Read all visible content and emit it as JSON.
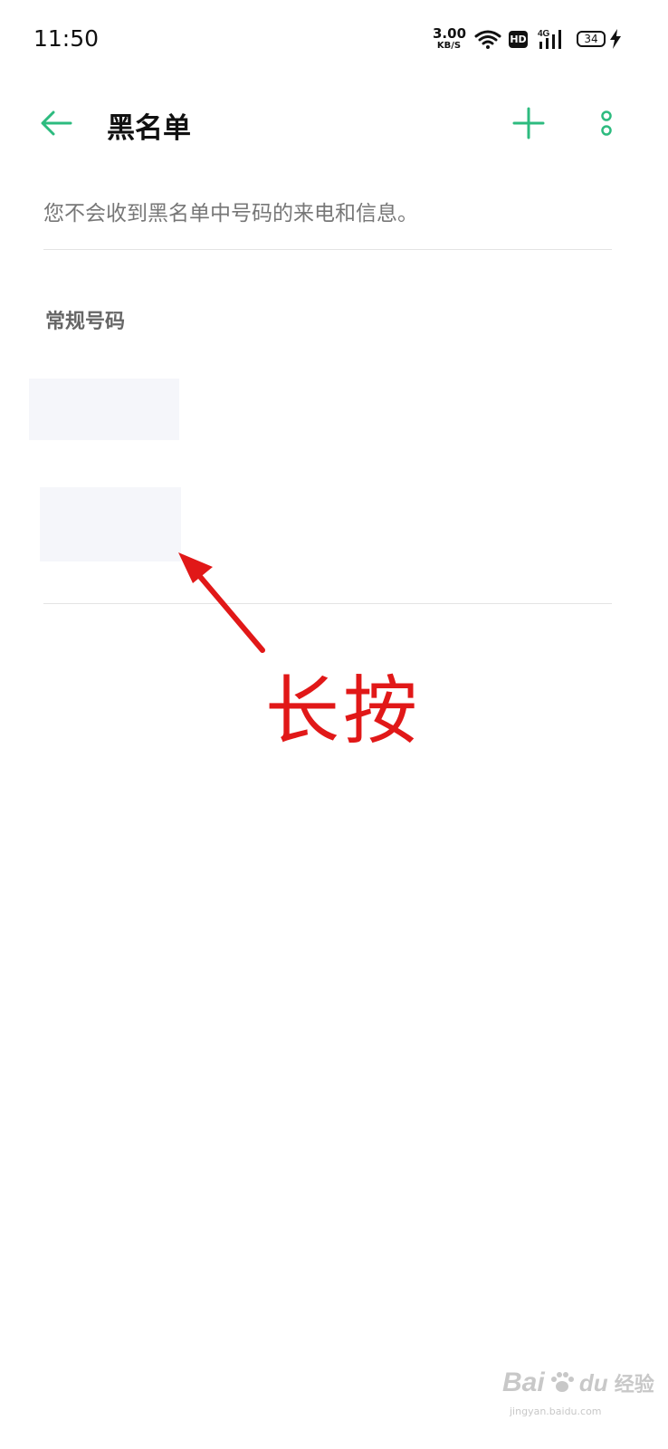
{
  "status_bar": {
    "time": "11:50",
    "net_speed_value": "3.00",
    "net_speed_unit": "KB/S",
    "hd": "HD",
    "network": "4G",
    "battery": "34"
  },
  "toolbar": {
    "title": "黑名单"
  },
  "description": "您不会收到黑名单中号码的来电和信息。",
  "section": {
    "title": "常规号码"
  },
  "annotation": {
    "label": "长按",
    "color": "#e11818"
  },
  "watermark": {
    "brand": "Bai",
    "brand_mid": "du",
    "brand_cn": "经验",
    "site": "jingyan.baidu.com"
  },
  "colors": {
    "accent": "#2dbb7f",
    "text_secondary": "#777777",
    "divider": "#e4e4e4"
  }
}
